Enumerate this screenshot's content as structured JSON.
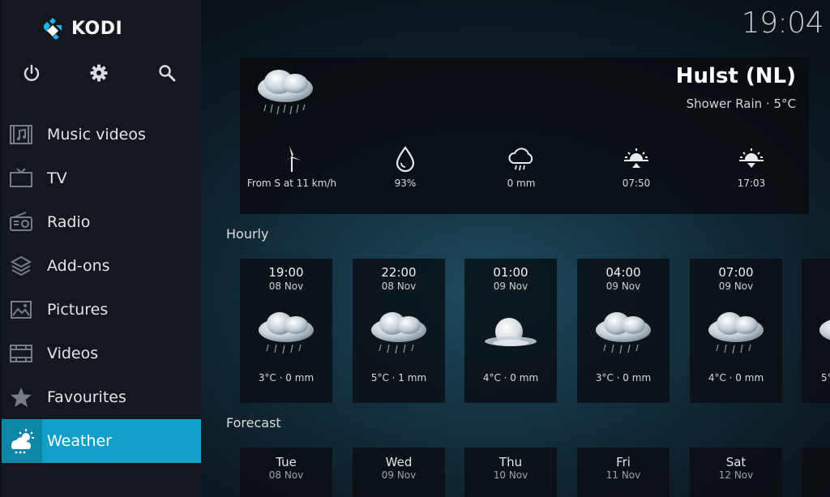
{
  "app": {
    "name": "KODI"
  },
  "clock": "19:04",
  "sidebar": {
    "top_icons": [
      "power-icon",
      "gear-icon",
      "search-icon"
    ],
    "items": [
      {
        "label": "Music videos",
        "icon": "music-video-icon"
      },
      {
        "label": "TV",
        "icon": "tv-icon"
      },
      {
        "label": "Radio",
        "icon": "radio-icon"
      },
      {
        "label": "Add-ons",
        "icon": "addons-icon"
      },
      {
        "label": "Pictures",
        "icon": "pictures-icon"
      },
      {
        "label": "Videos",
        "icon": "film-icon"
      },
      {
        "label": "Favourites",
        "icon": "star-icon"
      },
      {
        "label": "Weather",
        "icon": "weather-icon",
        "active": true
      }
    ]
  },
  "current": {
    "location": "Hulst (NL)",
    "condition": "Shower Rain · 5°C",
    "stats": [
      {
        "icon": "wind-turbine-icon",
        "value": "From S at 11 km/h"
      },
      {
        "icon": "humidity-drop-icon",
        "value": "93%"
      },
      {
        "icon": "rain-cloud-icon",
        "value": "0 mm"
      },
      {
        "icon": "sunrise-icon",
        "value": "07:50"
      },
      {
        "icon": "sunset-icon",
        "value": "17:03"
      }
    ]
  },
  "hourly": {
    "title": "Hourly",
    "items": [
      {
        "time": "19:00",
        "date": "08 Nov",
        "summary": "3°C · 0 mm",
        "icon": "rain-cloud-icon"
      },
      {
        "time": "22:00",
        "date": "08 Nov",
        "summary": "5°C · 1 mm",
        "icon": "rain-cloud-icon"
      },
      {
        "time": "01:00",
        "date": "09 Nov",
        "summary": "4°C · 0 mm",
        "icon": "moon-cloud-icon"
      },
      {
        "time": "04:00",
        "date": "09 Nov",
        "summary": "3°C · 0 mm",
        "icon": "rain-cloud-icon"
      },
      {
        "time": "07:00",
        "date": "09 Nov",
        "summary": "4°C · 0 mm",
        "icon": "rain-cloud-icon"
      }
    ],
    "partial_summary": "5°"
  },
  "forecast": {
    "title": "Forecast",
    "items": [
      {
        "day": "Tue",
        "date": "08 Nov"
      },
      {
        "day": "Wed",
        "date": "09 Nov"
      },
      {
        "day": "Thu",
        "date": "10 Nov"
      },
      {
        "day": "Fri",
        "date": "11 Nov"
      },
      {
        "day": "Sat",
        "date": "12 Nov"
      }
    ]
  },
  "colors": {
    "accent": "#12a0c8",
    "sidebar": "#12181e",
    "card": "#0a0e12"
  }
}
